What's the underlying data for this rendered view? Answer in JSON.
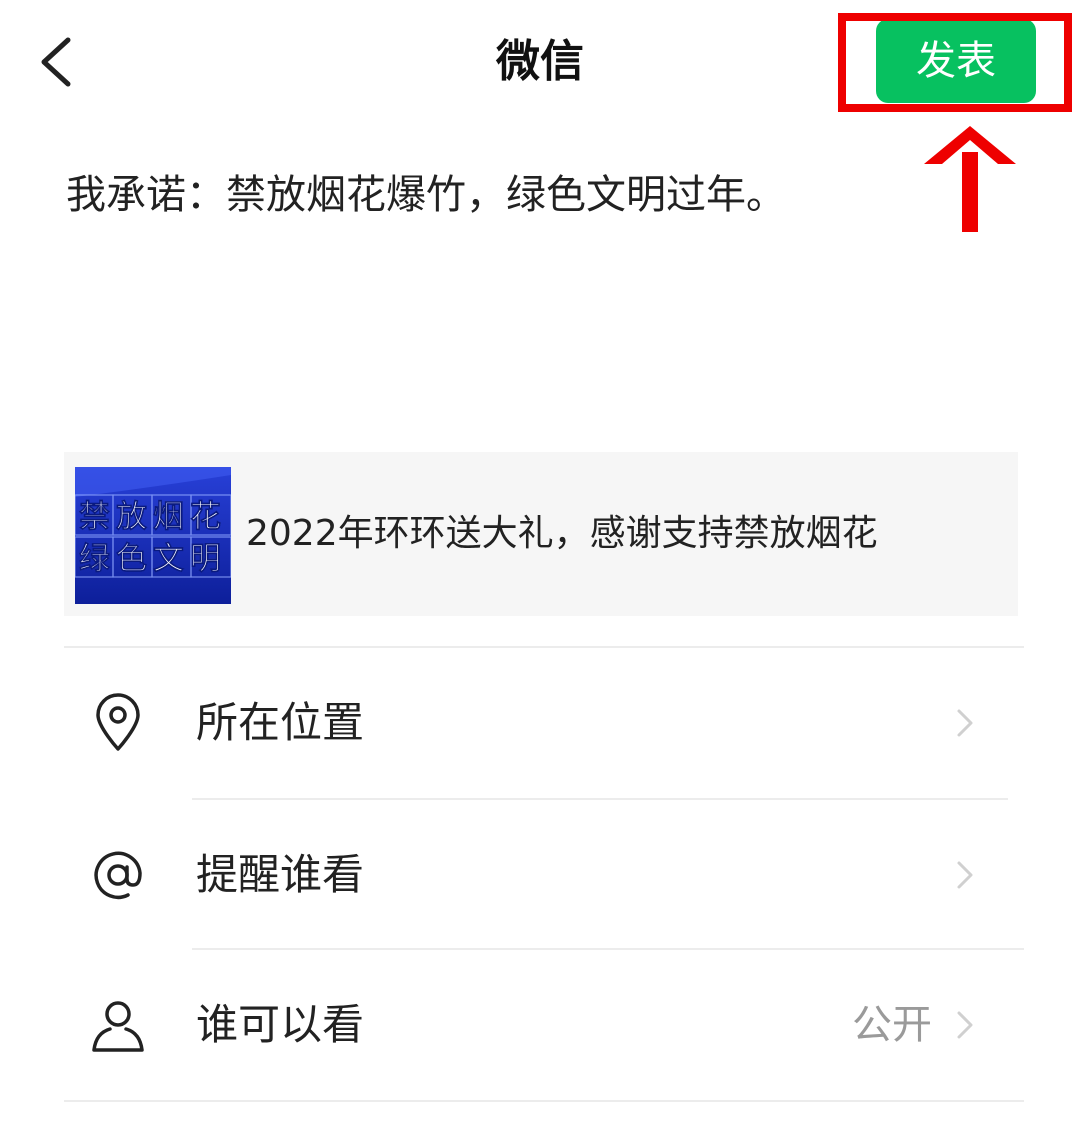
{
  "nav": {
    "title": "微信",
    "publish_label": "发表"
  },
  "post": {
    "text": "我承诺：禁放烟花爆竹，绿色文明过年。"
  },
  "share_card": {
    "thumbnail_text_line1": "禁放烟花",
    "thumbnail_text_line2": "绿色文明",
    "title": "2022年环环送大礼，感谢支持禁放烟花"
  },
  "options": [
    {
      "label": "所在位置",
      "icon": "location-pin-icon",
      "value": ""
    },
    {
      "label": "提醒谁看",
      "icon": "at-icon",
      "value": ""
    },
    {
      "label": "谁可以看",
      "icon": "person-icon",
      "value": "公开"
    }
  ],
  "colors": {
    "publish_green": "#07c160",
    "highlight_red": "#ee0000",
    "card_bg": "#f6f6f6",
    "thumb_blue": "#1a2fc4"
  }
}
